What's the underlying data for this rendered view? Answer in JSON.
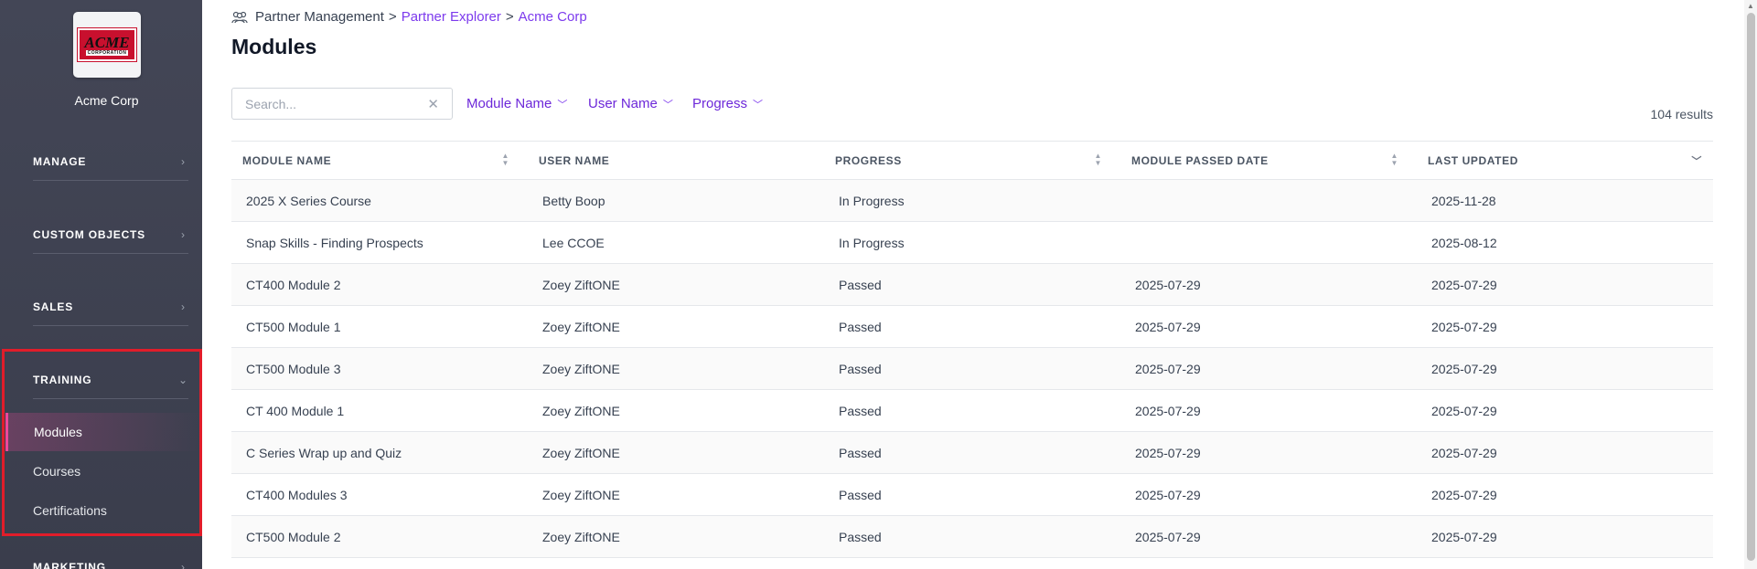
{
  "sidebar": {
    "logo": {
      "text_big": "ACME",
      "text_small": "CORPORATION"
    },
    "company_name": "Acme Corp",
    "sections": [
      {
        "label": "MANAGE"
      },
      {
        "label": "CUSTOM OBJECTS"
      },
      {
        "label": "SALES"
      },
      {
        "label": "TRAINING"
      },
      {
        "label": "MARKETING"
      }
    ],
    "training_items": [
      {
        "label": "Modules",
        "active": true
      },
      {
        "label": "Courses"
      },
      {
        "label": "Certifications"
      }
    ]
  },
  "breadcrumb": {
    "root": "Partner Management",
    "sep1": ">",
    "level2": "Partner Explorer",
    "sep2": ">",
    "level3": "Acme Corp"
  },
  "page_title": "Modules",
  "search": {
    "placeholder": "Search...",
    "value": ""
  },
  "filters": [
    {
      "label": "Module Name"
    },
    {
      "label": "User Name"
    },
    {
      "label": "Progress"
    }
  ],
  "results_count": "104 results",
  "table": {
    "columns": [
      "MODULE NAME",
      "USER NAME",
      "PROGRESS",
      "MODULE PASSED DATE",
      "LAST UPDATED"
    ],
    "rows": [
      {
        "module": "2025 X Series Course",
        "user": "Betty Boop",
        "progress": "In Progress",
        "passed": "",
        "updated": "2025-11-28"
      },
      {
        "module": "Snap Skills - Finding Prospects",
        "user": "Lee CCOE",
        "progress": "In Progress",
        "passed": "",
        "updated": "2025-08-12"
      },
      {
        "module": "CT400 Module 2",
        "user": "Zoey ZiftONE",
        "progress": "Passed",
        "passed": "2025-07-29",
        "updated": "2025-07-29"
      },
      {
        "module": "CT500 Module 1",
        "user": "Zoey ZiftONE",
        "progress": "Passed",
        "passed": "2025-07-29",
        "updated": "2025-07-29"
      },
      {
        "module": "CT500 Module 3",
        "user": "Zoey ZiftONE",
        "progress": "Passed",
        "passed": "2025-07-29",
        "updated": "2025-07-29"
      },
      {
        "module": "CT 400 Module 1",
        "user": "Zoey ZiftONE",
        "progress": "Passed",
        "passed": "2025-07-29",
        "updated": "2025-07-29"
      },
      {
        "module": "C Series Wrap up and Quiz",
        "user": "Zoey ZiftONE",
        "progress": "Passed",
        "passed": "2025-07-29",
        "updated": "2025-07-29"
      },
      {
        "module": "CT400 Modules 3",
        "user": "Zoey ZiftONE",
        "progress": "Passed",
        "passed": "2025-07-29",
        "updated": "2025-07-29"
      },
      {
        "module": "CT500 Module 2",
        "user": "Zoey ZiftONE",
        "progress": "Passed",
        "passed": "2025-07-29",
        "updated": "2025-07-29"
      }
    ]
  },
  "colors": {
    "accent": "#7c3aed",
    "sidebar": "#3f4251",
    "highlight": "#e11d2a",
    "active_marker": "#ec4899"
  }
}
